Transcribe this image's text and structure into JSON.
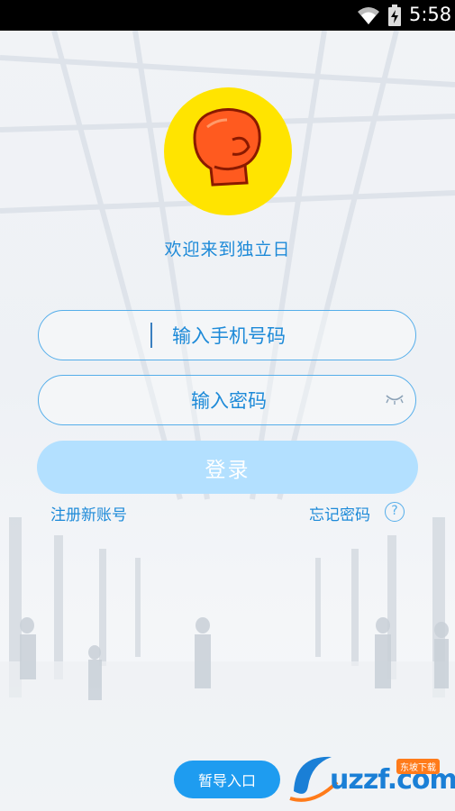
{
  "status_bar": {
    "time": "5:58"
  },
  "welcome": "欢迎来到独立日",
  "phone_field": {
    "placeholder": "输入手机号码"
  },
  "password_field": {
    "placeholder": "输入密码"
  },
  "login_label": "登录",
  "register_label": "注册新账号",
  "forgot_label": "忘记密码",
  "help_glyph": "?",
  "guide_label": "暂导入口",
  "watermark": {
    "text": "uzzf.com",
    "tag": "东坡下载"
  },
  "colors": {
    "accent": "#1d8ad8",
    "logo_bg": "#ffe400",
    "button": "#b3e0ff",
    "guide_button": "#1e9cf0"
  },
  "icons": [
    "wifi-icon",
    "battery-icon",
    "boxing-glove-icon",
    "eye-closed-icon",
    "help-icon"
  ]
}
